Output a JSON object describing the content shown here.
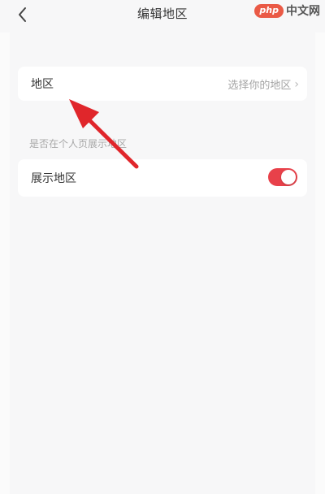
{
  "header": {
    "title": "编辑地区",
    "back_icon": "chevron-left-icon"
  },
  "watermark": {
    "badge": "php",
    "text": "中文网"
  },
  "region_row": {
    "label": "地区",
    "value": "选择你的地区",
    "chevron": "›"
  },
  "section": {
    "hint": "是否在个人页展示地区"
  },
  "toggle_row": {
    "label": "展示地区",
    "enabled": true
  },
  "colors": {
    "accent": "#e8414a",
    "annotation_arrow": "#e0262b",
    "background": "#f7f7f8"
  }
}
